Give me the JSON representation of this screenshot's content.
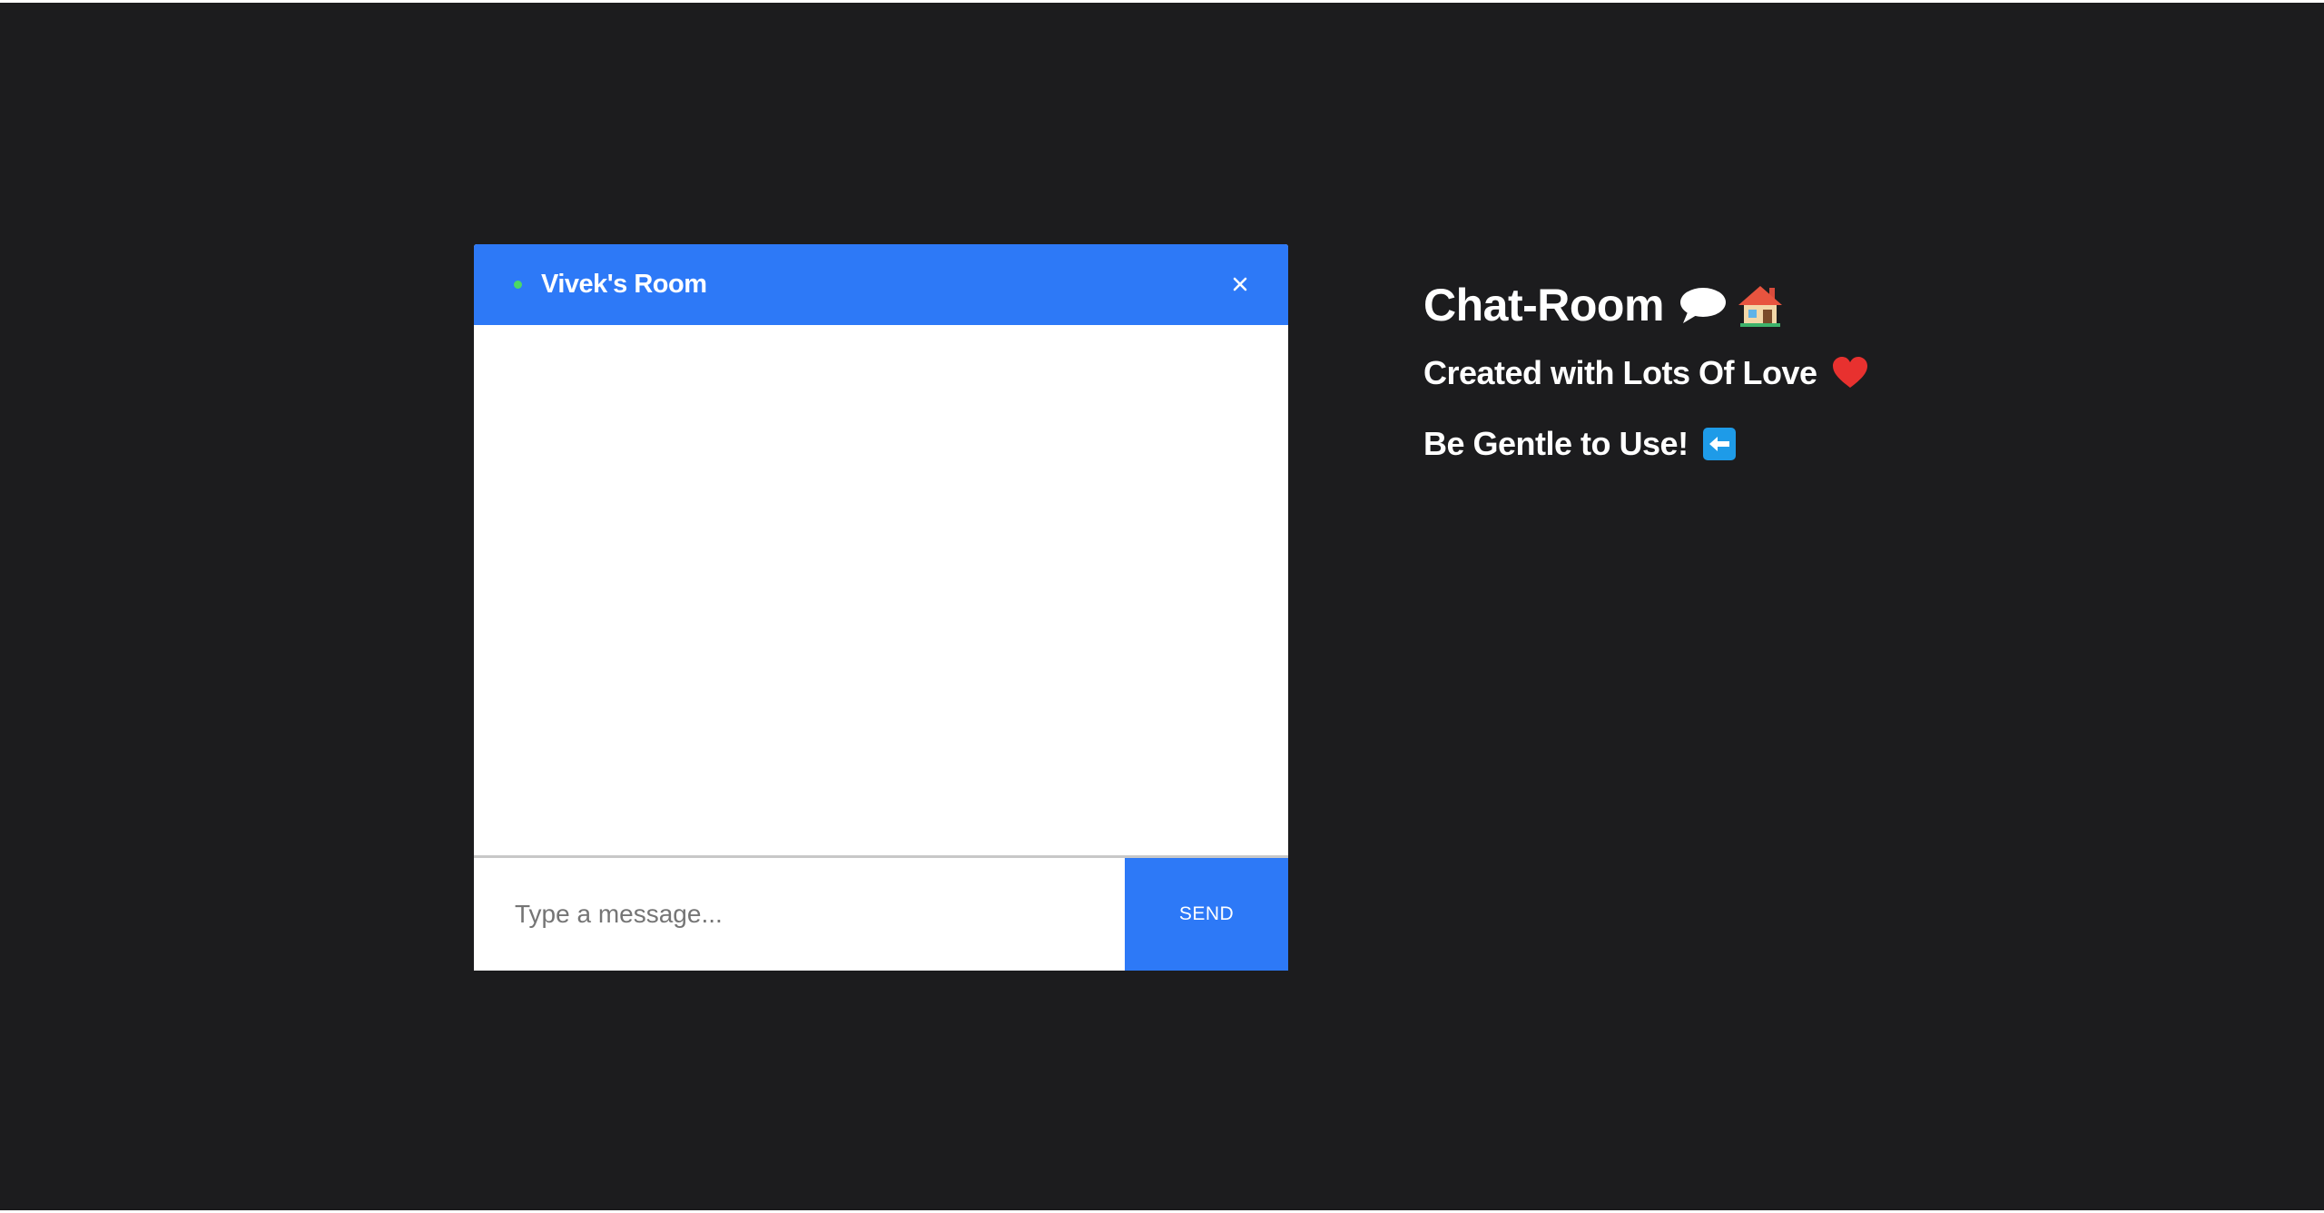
{
  "chat": {
    "room_title": "Vivek's Room",
    "close_symbol": "×",
    "input_placeholder": "Type a message...",
    "input_value": "",
    "send_label": "SEND"
  },
  "info": {
    "title": "Chat-Room",
    "line2": "Created with Lots Of Love",
    "line3": "Be Gentle to Use!",
    "icons": [
      "speech-bubble-icon",
      "house-icon",
      "heart-icon",
      "left-arrow-icon"
    ]
  },
  "colors": {
    "background": "#1c1c1e",
    "accent": "#2d79f7",
    "online": "#4cd964",
    "heart": "#e8312f",
    "arrow_box": "#1e9be8"
  }
}
